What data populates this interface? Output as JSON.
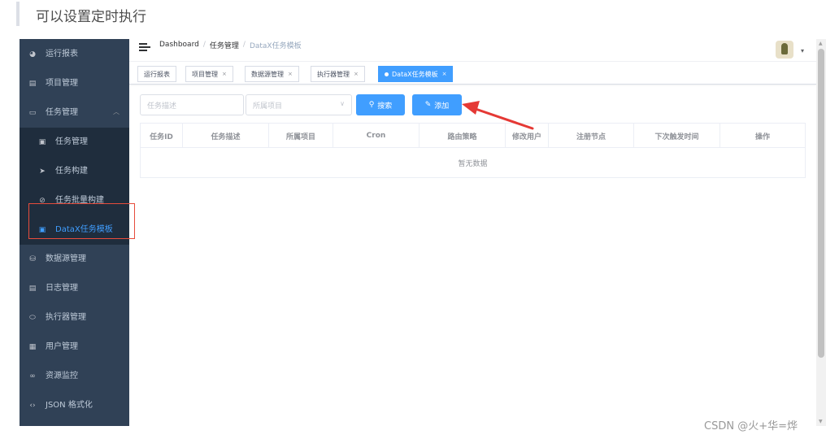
{
  "blog_caption": "可以设置定时执行",
  "sidebar": {
    "items": [
      {
        "label": "运行报表",
        "icon": "dashboard-icon",
        "icon_char": "◕",
        "sub": false,
        "active": false
      },
      {
        "label": "项目管理",
        "icon": "project-icon",
        "icon_char": "▤",
        "sub": false,
        "active": false
      },
      {
        "label": "任务管理",
        "icon": "task-icon",
        "icon_char": "▭",
        "sub": false,
        "active": false,
        "expanded": true
      },
      {
        "label": "任务管理",
        "icon": "task-list-icon",
        "icon_char": "▣",
        "sub": true,
        "active": false
      },
      {
        "label": "任务构建",
        "icon": "send-icon",
        "icon_char": "➤",
        "sub": true,
        "active": false
      },
      {
        "label": "任务批量构建",
        "icon": "batch-icon",
        "icon_char": "⊘",
        "sub": true,
        "active": false
      },
      {
        "label": "DataX任务模板",
        "icon": "template-icon",
        "icon_char": "▣",
        "sub": true,
        "active": true
      },
      {
        "label": "数据源管理",
        "icon": "datasource-icon",
        "icon_char": "⛁",
        "sub": false,
        "active": false
      },
      {
        "label": "日志管理",
        "icon": "log-icon",
        "icon_char": "▤",
        "sub": false,
        "active": false
      },
      {
        "label": "执行器管理",
        "icon": "executor-icon",
        "icon_char": "⬭",
        "sub": false,
        "active": false
      },
      {
        "label": "用户管理",
        "icon": "user-table-icon",
        "icon_char": "▦",
        "sub": false,
        "active": false
      },
      {
        "label": "资源监控",
        "icon": "monitor-icon",
        "icon_char": "∞",
        "sub": false,
        "active": false
      },
      {
        "label": "JSON 格式化",
        "icon": "json-icon",
        "icon_char": "‹›",
        "sub": false,
        "active": false
      }
    ]
  },
  "navbar": {
    "breadcrumb": [
      "Dashboard",
      "任务管理",
      "DataX任务模板"
    ],
    "breadcrumb_sep": "/"
  },
  "tags": [
    {
      "label": "运行报表",
      "closable": false,
      "active": false
    },
    {
      "label": "项目管理",
      "closable": true,
      "active": false
    },
    {
      "label": "数据源管理",
      "closable": true,
      "active": false
    },
    {
      "label": "执行器管理",
      "closable": true,
      "active": false
    },
    {
      "label": "DataX任务模板",
      "closable": true,
      "active": true
    }
  ],
  "tag_close": "×",
  "filters": {
    "task_desc_placeholder": "任务描述",
    "project_placeholder": "所属项目",
    "search_label": "搜索",
    "add_label": "添加"
  },
  "table": {
    "columns": [
      "任务ID",
      "任务描述",
      "所属项目",
      "Cron",
      "路由策略",
      "修改用户",
      "注册节点",
      "下次触发时间",
      "操作"
    ],
    "empty_text": "暂无数据"
  },
  "watermark": "CSDN @火+华=烨",
  "colors": {
    "sidebar_bg": "#304156",
    "submenu_bg": "#1f2d3d",
    "accent": "#409eff",
    "highlight_red": "#e74c3c"
  }
}
